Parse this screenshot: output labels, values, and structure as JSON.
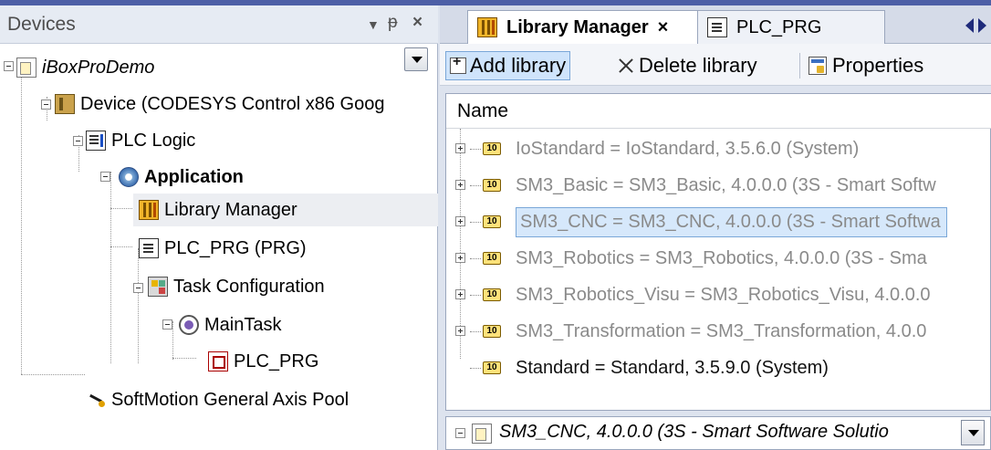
{
  "devices_panel": {
    "title": "Devices",
    "controls": {
      "menu": "▼",
      "pin": "ᵽ",
      "close": "×"
    }
  },
  "tree": {
    "project": "iBoxProDemo",
    "device": "Device (CODESYS Control x86 Goog",
    "plc_logic": "PLC Logic",
    "application": "Application",
    "library_manager": "Library Manager",
    "plc_prg": "PLC_PRG (PRG)",
    "task_configuration": "Task Configuration",
    "main_task": "MainTask",
    "main_task_pou": "PLC_PRG",
    "axis_pool": "SoftMotion General Axis Pool"
  },
  "tabs": {
    "active": "Library Manager",
    "active_close": "×",
    "other": "PLC_PRG"
  },
  "toolbar": {
    "add_library": "Add library",
    "delete_library": "Delete library",
    "properties": "Properties"
  },
  "library_list": {
    "column_name": "Name",
    "items": [
      "IoStandard = IoStandard, 3.5.6.0 (System)",
      "SM3_Basic = SM3_Basic, 4.0.0.0 (3S - Smart Softw",
      "SM3_CNC = SM3_CNC, 4.0.0.0 (3S - Smart Softwa",
      "SM3_Robotics = SM3_Robotics, 4.0.0.0 (3S - Sma",
      "SM3_Robotics_Visu = SM3_Robotics_Visu, 4.0.0.0",
      "SM3_Transformation = SM3_Transformation, 4.0.0",
      "Standard = Standard, 3.5.9.0 (System)"
    ],
    "selected_index": 2
  },
  "detail": {
    "text": "SM3_CNC, 4.0.0.0 (3S - Smart Software Solutio"
  },
  "colors": {
    "title_bar": "#4d5fa6",
    "selection": "#d6e8fb",
    "disabled_text": "#8a8a8a"
  }
}
